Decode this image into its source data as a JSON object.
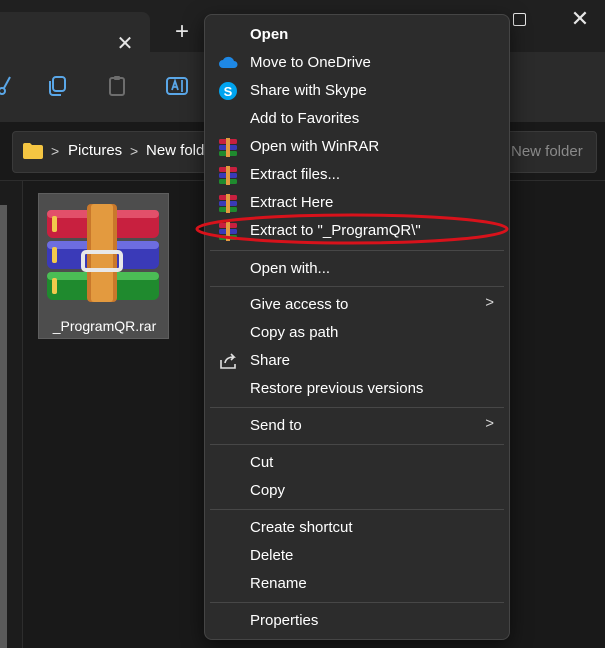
{
  "window": {
    "tab_close": "✕",
    "new_tab": "+",
    "close": "✕"
  },
  "breadcrumb": {
    "separator": ">",
    "items": [
      "Pictures",
      "New fold"
    ]
  },
  "search": {
    "placeholder": "New folder"
  },
  "file": {
    "name": "_ProgramQR.rar",
    "icon": "winrar-archive-icon"
  },
  "context_menu": {
    "items": [
      {
        "label": "Open",
        "bold": true,
        "icon": ""
      },
      {
        "label": "Move to OneDrive",
        "icon": "onedrive-icon"
      },
      {
        "label": "Share with Skype",
        "icon": "skype-icon"
      },
      {
        "label": "Add to Favorites",
        "icon": ""
      },
      {
        "label": "Open with WinRAR",
        "icon": "winrar-icon"
      },
      {
        "label": "Extract files...",
        "icon": "winrar-icon"
      },
      {
        "label": "Extract Here",
        "icon": "winrar-icon"
      },
      {
        "label": "Extract to \"_ProgramQR\\\"",
        "icon": "winrar-icon",
        "highlighted_by_annotation": true
      },
      {
        "label": "Open with...",
        "icon": ""
      },
      {
        "label": "Give access to",
        "icon": "",
        "submenu": true
      },
      {
        "label": "Copy as path",
        "icon": ""
      },
      {
        "label": "Share",
        "icon": "share-icon"
      },
      {
        "label": "Restore previous versions",
        "icon": ""
      },
      {
        "label": "Send to",
        "icon": "",
        "submenu": true
      },
      {
        "label": "Cut",
        "icon": ""
      },
      {
        "label": "Copy",
        "icon": ""
      },
      {
        "label": "Create shortcut",
        "icon": ""
      },
      {
        "label": "Delete",
        "icon": ""
      },
      {
        "label": "Rename",
        "icon": ""
      },
      {
        "label": "Properties",
        "icon": ""
      }
    ],
    "submenu_arrow": ">"
  },
  "colors": {
    "background": "#191919",
    "menu_background": "#2c2c2c",
    "annotation_red": "#d8121b",
    "onedrive_blue": "#1e88e5",
    "skype_blue": "#00a4ef",
    "folder_yellow": "#f4c542"
  }
}
